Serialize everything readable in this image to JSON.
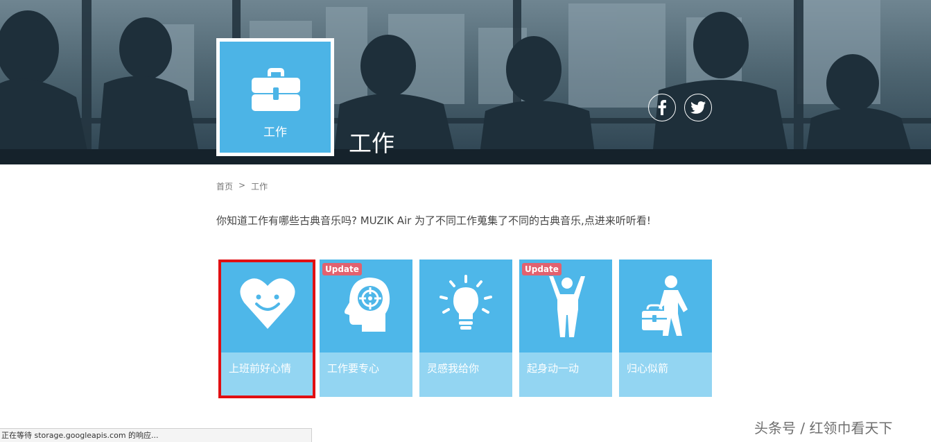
{
  "hero": {
    "tile_label": "工作",
    "title": "工作",
    "social": [
      "f",
      "twitter"
    ]
  },
  "breadcrumb": {
    "home": "首页",
    "separator": ">",
    "current": "工作"
  },
  "intro": "你知道工作有哪些古典音乐吗? MUZIK Air 为了不同工作蒐集了不同的古典音乐,点进来听听看!",
  "cards": [
    {
      "label": "上班前好心情",
      "icon": "smiling-heart-icon",
      "badge": "",
      "selected": true
    },
    {
      "label": "工作要专心",
      "icon": "focused-head-icon",
      "badge": "Update",
      "selected": false
    },
    {
      "label": "灵感我给你",
      "icon": "lightbulb-icon",
      "badge": "",
      "selected": false
    },
    {
      "label": "起身动一动",
      "icon": "person-stretching-icon",
      "badge": "Update",
      "selected": false
    },
    {
      "label": "归心似箭",
      "icon": "person-with-briefcase-icon",
      "badge": "",
      "selected": false
    }
  ],
  "status_bar": "正在等待 storage.googleapis.com 的响应...",
  "watermark": "头条号 / 红领巾看天下",
  "colors": {
    "accent": "#4eb7e9",
    "card_bottom": "#93d5f2",
    "badge": "#e2616f",
    "selection": "#e10f12"
  }
}
